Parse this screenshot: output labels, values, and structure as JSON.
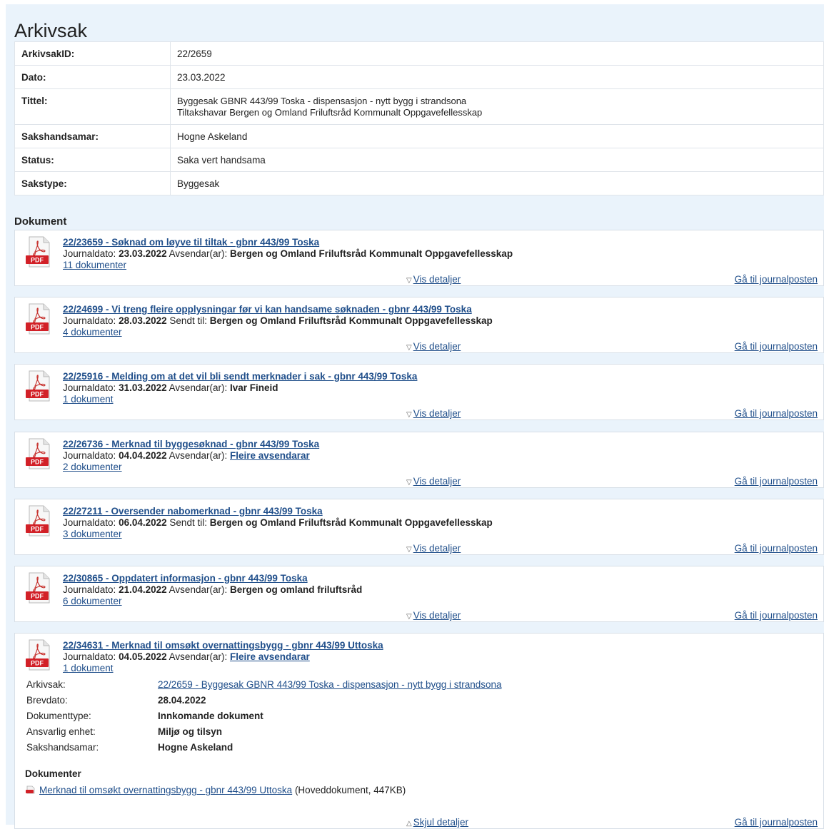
{
  "page": {
    "title": "Arkivsak",
    "documents_heading": "Dokument"
  },
  "info": [
    {
      "label": "ArkivsakID:",
      "values": [
        "22/2659"
      ]
    },
    {
      "label": "Dato:",
      "values": [
        "23.03.2022"
      ]
    },
    {
      "label": "Tittel:",
      "values": [
        "Byggesak GBNR 443/99 Toska - dispensasjon - nytt bygg i strandsona",
        "Tiltakshavar Bergen og Omland Friluftsråd Kommunalt Oppgavefellesskap"
      ]
    },
    {
      "label": "Sakshandsamar:",
      "values": [
        "Hogne Askeland"
      ]
    },
    {
      "label": "Status:",
      "values": [
        "Saka vert handsama"
      ]
    },
    {
      "label": "Sakstype:",
      "values": [
        "Byggesak"
      ]
    }
  ],
  "common": {
    "journal_label": "Journaldato:",
    "show_details": "Vis detaljer",
    "hide_details": "Skjul detaljer",
    "go_to_journal": "Gå til journalposten",
    "pdf_label": "PDF"
  },
  "docs": [
    {
      "title": "22/23659 - Søknad om løyve til tiltak - gbnr 443/99 Toska",
      "date": "23.03.2022",
      "party_label": "Avsendar(ar):",
      "party": "Bergen og Omland Friluftsråd Kommunalt Oppgavefellesskap",
      "party_is_link": false,
      "count": "11 dokumenter"
    },
    {
      "title": "22/24699 - Vi treng fleire opplysningar før vi kan handsame søknaden - gbnr 443/99 Toska",
      "date": "28.03.2022",
      "party_label": "Sendt til:",
      "party": "Bergen og Omland Friluftsråd Kommunalt Oppgavefellesskap",
      "party_is_link": false,
      "count": "4 dokumenter"
    },
    {
      "title": "22/25916 - Melding om at det vil bli sendt merknader i sak - gbnr 443/99 Toska",
      "date": "31.03.2022",
      "party_label": "Avsendar(ar):",
      "party": "Ivar Fineid",
      "party_is_link": false,
      "count": "1 dokument"
    },
    {
      "title": "22/26736 - Merknad til byggesøknad - gbnr 443/99 Toska",
      "date": "04.04.2022",
      "party_label": "Avsendar(ar):",
      "party": "Fleire avsendarar",
      "party_is_link": true,
      "count": "2 dokumenter"
    },
    {
      "title": "22/27211 - Oversender nabomerknad - gbnr 443/99 Toska",
      "date": "06.04.2022",
      "party_label": "Sendt til:",
      "party": "Bergen og Omland Friluftsråd Kommunalt Oppgavefellesskap",
      "party_is_link": false,
      "count": "3 dokumenter"
    },
    {
      "title": "22/30865 - Oppdatert informasjon - gbnr 443/99 Toska",
      "date": "21.04.2022",
      "party_label": "Avsendar(ar):",
      "party": "Bergen og omland friluftsråd",
      "party_is_link": false,
      "count": "6 dokumenter"
    },
    {
      "title": "22/34631 - Merknad til omsøkt overnattingsbygg - gbnr 443/99 Uttoska",
      "date": "04.05.2022",
      "party_label": "Avsendar(ar):",
      "party": "Fleire avsendarar",
      "party_is_link": true,
      "count": "1 dokument"
    }
  ],
  "expanded": {
    "rows": [
      {
        "label": "Arkivsak:",
        "value": "22/2659 - Byggesak GBNR 443/99 Toska - dispensasjon - nytt bygg i strandsona",
        "is_link": true
      },
      {
        "label": "Brevdato:",
        "value": "28.04.2022",
        "is_link": false
      },
      {
        "label": "Dokumenttype:",
        "value": "Innkomande dokument",
        "is_link": false
      },
      {
        "label": "Ansvarlig enhet:",
        "value": "Miljø og tilsyn",
        "is_link": false
      },
      {
        "label": "Sakshandsamar:",
        "value": "Hogne Askeland",
        "is_link": false
      }
    ],
    "documents_heading": "Dokumenter",
    "file_link": "Merknad til omsøkt overnattingsbygg - gbnr 443/99 Uttoska",
    "file_meta": "(Hoveddokument, 447KB)"
  },
  "colors": {
    "panel_bg": "#eaf3fb",
    "link": "#1f4e8a",
    "pdf_red": "#d22027"
  }
}
